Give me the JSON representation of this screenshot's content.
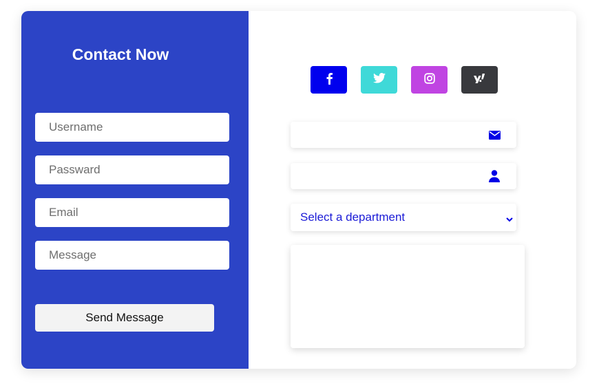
{
  "form": {
    "title": "Contact Now",
    "fields": {
      "username": {
        "placeholder": "Username",
        "value": ""
      },
      "password": {
        "placeholder": "Passward",
        "value": ""
      },
      "email": {
        "placeholder": "Email",
        "value": ""
      },
      "message": {
        "placeholder": "Message",
        "value": ""
      }
    },
    "send_label": "Send Message"
  },
  "social": [
    {
      "icon": "facebook-icon",
      "color": "#0000ee"
    },
    {
      "icon": "twitter-icon",
      "color": "#3fd9d8"
    },
    {
      "icon": "instagram-icon",
      "color": "#c044e2"
    },
    {
      "icon": "yahoo-icon",
      "color": "#38393d"
    }
  ],
  "right": {
    "email_icon": "envelope-icon",
    "user_icon": "user-icon",
    "department_select": {
      "selected": "Select a department"
    },
    "accent_color": "#0000e6"
  },
  "colors": {
    "panel": "#2c44c6",
    "button": "#f3f3f3"
  }
}
